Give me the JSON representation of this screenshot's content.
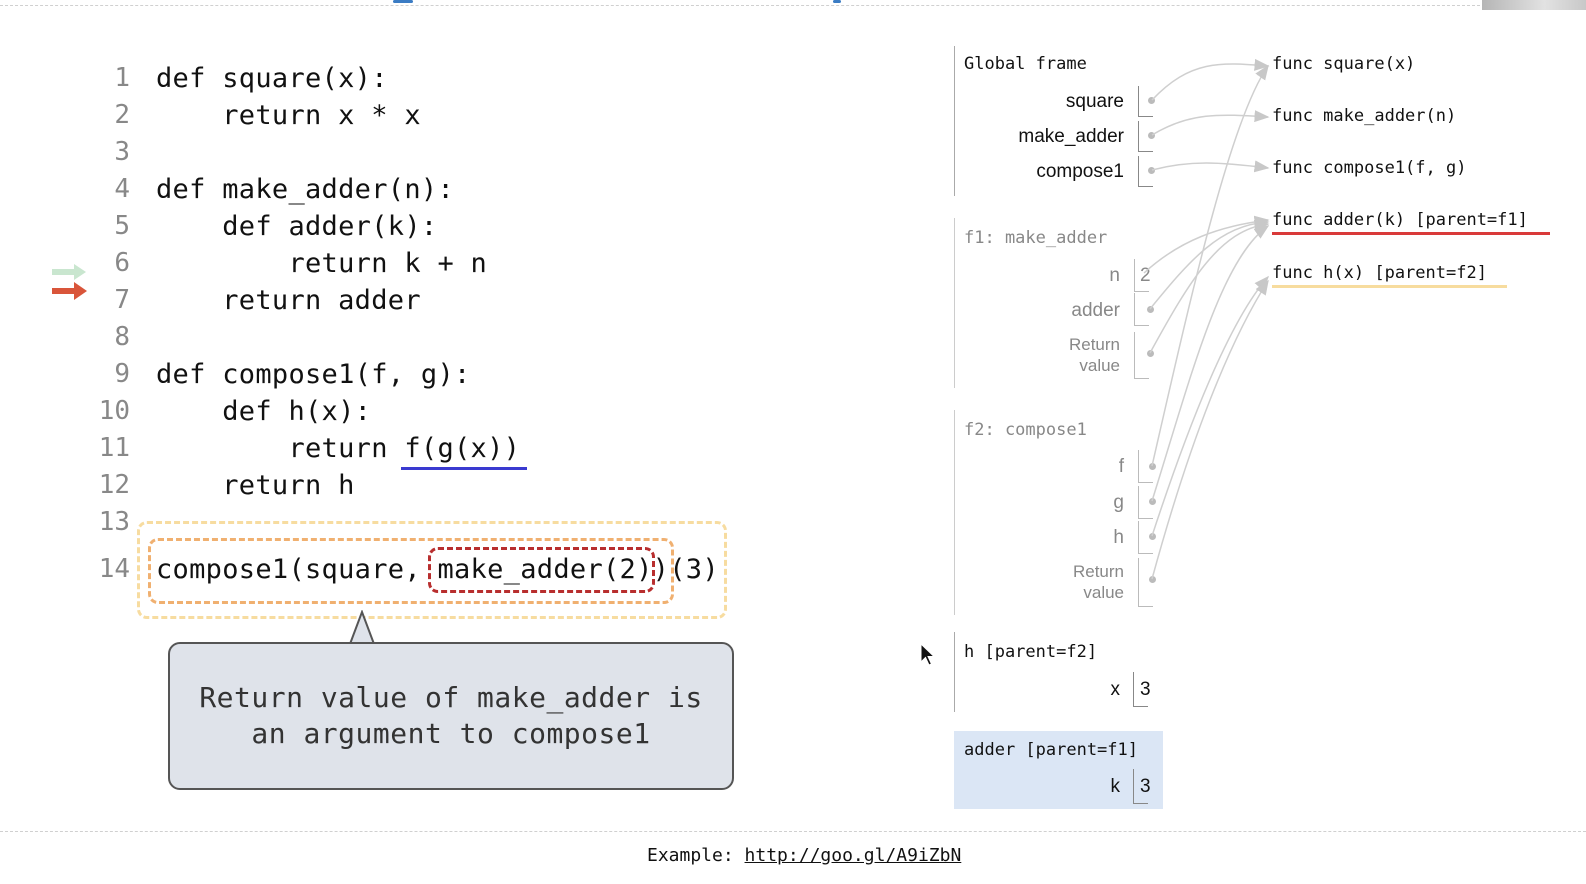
{
  "code": {
    "lines": [
      {
        "num": "1",
        "text": "def square(x):"
      },
      {
        "num": "2",
        "text": "    return x * x"
      },
      {
        "num": "3",
        "text": ""
      },
      {
        "num": "4",
        "text": "def make_adder(n):"
      },
      {
        "num": "5",
        "text": "    def adder(k):"
      },
      {
        "num": "6",
        "text": "        return k + n"
      },
      {
        "num": "7",
        "text": "    return adder"
      },
      {
        "num": "8",
        "text": ""
      },
      {
        "num": "9",
        "text": "def compose1(f, g):"
      },
      {
        "num": "10",
        "text": "    def h(x):"
      },
      {
        "num": "11",
        "text": "        return f(g(x))"
      },
      {
        "num": "12",
        "text": "    return h"
      },
      {
        "num": "13",
        "text": ""
      },
      {
        "num": "14",
        "text": "compose1(square, make_adder(2))(3)"
      }
    ],
    "prev_line_arrow_color": "#c9e6cf",
    "current_line_arrow_color": "#d9553a"
  },
  "callout": {
    "text": "Return value of make_adder is\nan argument to compose1"
  },
  "frames": {
    "global": {
      "title": "Global frame",
      "vars": [
        {
          "name": "square"
        },
        {
          "name": "make_adder"
        },
        {
          "name": "compose1"
        }
      ]
    },
    "f1": {
      "title": "f1: make_adder",
      "vars": [
        {
          "name": "n",
          "value": "2"
        },
        {
          "name": "adder"
        },
        {
          "name": "Return\nvalue"
        }
      ]
    },
    "f2": {
      "title": "f2: compose1",
      "vars": [
        {
          "name": "f"
        },
        {
          "name": "g"
        },
        {
          "name": "h"
        },
        {
          "name": "Return\nvalue"
        }
      ]
    },
    "h": {
      "title": "h [parent=f2]",
      "vars": [
        {
          "name": "x",
          "value": "3"
        }
      ]
    },
    "adder": {
      "title": "adder [parent=f1]",
      "vars": [
        {
          "name": "k",
          "value": "3"
        }
      ],
      "highlight_color": "#dbe6f5"
    }
  },
  "objects": [
    {
      "label": "func square(x)"
    },
    {
      "label": "func make_adder(n)"
    },
    {
      "label": "func compose1(f, g)"
    },
    {
      "label": "func adder(k) [parent=f1]"
    },
    {
      "label": "func h(x) [parent=f2]"
    }
  ],
  "footer": {
    "label": "Example: ",
    "link": "http://goo.gl/A9iZbN"
  }
}
